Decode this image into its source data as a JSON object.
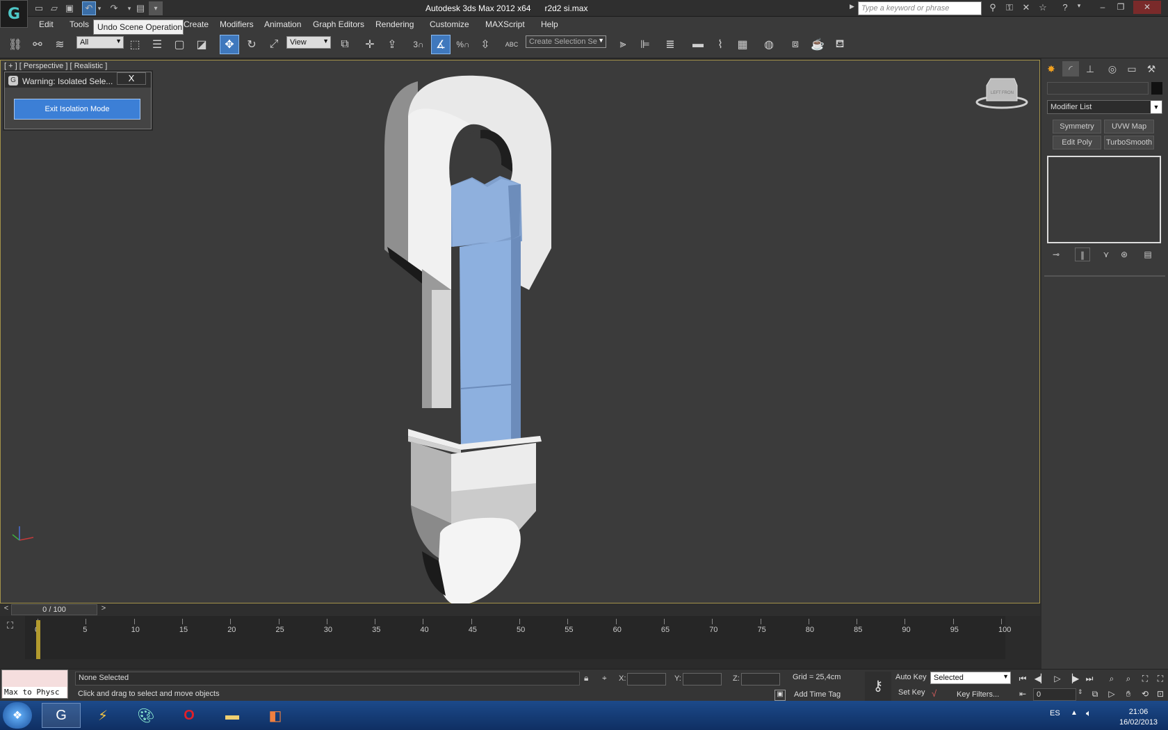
{
  "window": {
    "title": "Autodesk 3ds Max  2012 x64",
    "file": "r2d2 si.max"
  },
  "search": {
    "placeholder": "Type a keyword or phrase"
  },
  "tooltip": "Undo Scene Operation",
  "menu": [
    "Edit",
    "Tools",
    "Create",
    "Modifiers",
    "Animation",
    "Graph Editors",
    "Rendering",
    "Customize",
    "MAXScript",
    "Help"
  ],
  "toolbar": {
    "filter": "All",
    "refcoord": "View",
    "snap3": "3",
    "angle_pct": "%",
    "selset": "Create Selection Se",
    "abc": "ABC"
  },
  "viewport": {
    "label": "[ + ] [ Perspective ] [ Realistic ]",
    "viewcube_front": "FRON",
    "viewcube_left": "LEFT"
  },
  "warning": {
    "title": "Warning: Isolated Sele...",
    "close": "X",
    "button": "Exit Isolation Mode"
  },
  "panel": {
    "modifier_list": "Modifier List",
    "buttons": [
      "Symmetry",
      "UVW Map",
      "Edit Poly",
      "TurboSmooth"
    ]
  },
  "timeline": {
    "slider": "0 / 100",
    "prev": "<",
    "next": ">",
    "ticks": [
      "0",
      "5",
      "10",
      "15",
      "20",
      "25",
      "30",
      "35",
      "40",
      "45",
      "50",
      "55",
      "60",
      "65",
      "70",
      "75",
      "80",
      "85",
      "90",
      "95",
      "100"
    ]
  },
  "status": {
    "maxscript": "Max to Physc",
    "selection": "None Selected",
    "prompt": "Click and drag to select and move objects",
    "x_label": "X:",
    "y_label": "Y:",
    "z_label": "Z:",
    "grid": "Grid = 25,4cm",
    "add_time_tag": "Add Time Tag",
    "auto_key": "Auto Key",
    "set_key": "Set Key",
    "key_mode": "Selected",
    "key_filters": "Key Filters...",
    "frame": "0"
  },
  "taskbar": {
    "lang": "ES",
    "time": "21:06",
    "date": "16/02/2013"
  }
}
